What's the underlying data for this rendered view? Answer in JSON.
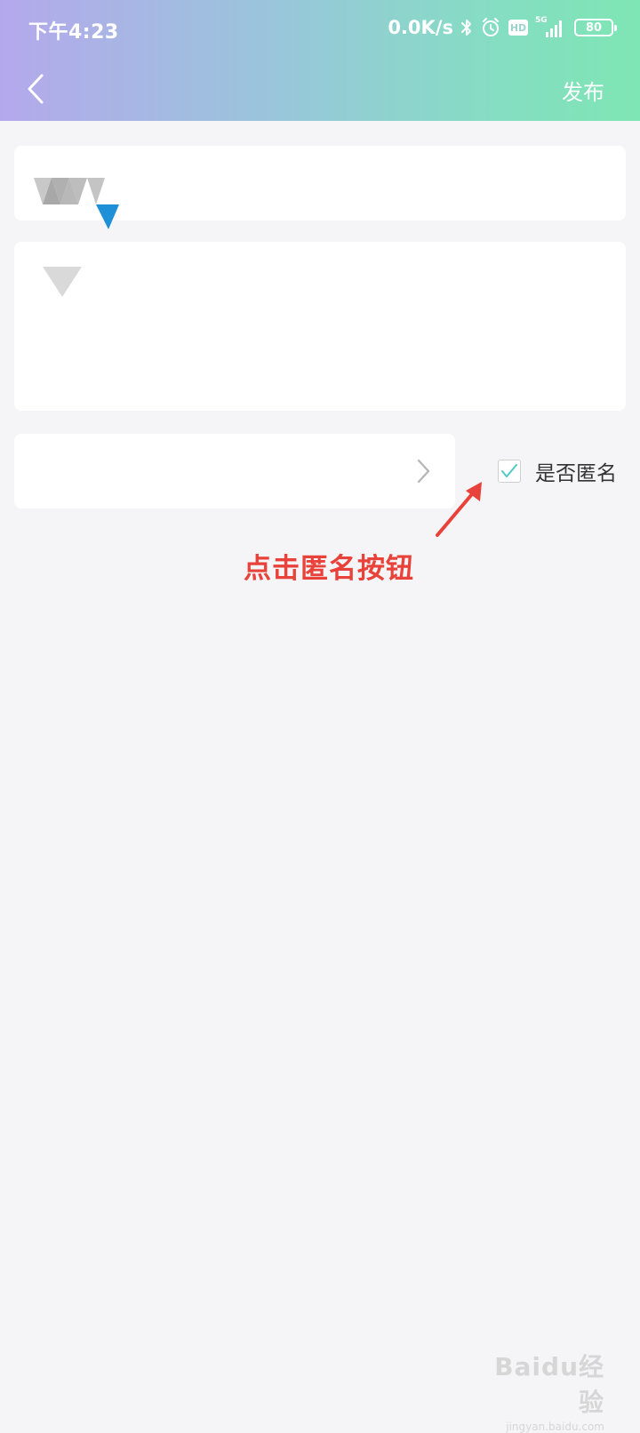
{
  "status_bar": {
    "time": "下午4:23",
    "net_speed": "0.0K/s",
    "hd_label": "HD",
    "network_label": "5G",
    "battery": "80",
    "icons": [
      "bluetooth-icon",
      "alarm-icon",
      "hd-icon",
      "signal-icon",
      "battery-icon"
    ]
  },
  "nav": {
    "back_icon": "chevron-left-icon",
    "publish_label": "发布"
  },
  "form": {
    "anonymous_label": "是否匿名",
    "anonymous_checked": true,
    "select_icon": "chevron-right-icon"
  },
  "annotation": {
    "text": "点击匿名按钮",
    "color": "#e8423a"
  },
  "watermark": {
    "main": "Baidu经验",
    "sub": "jingyan.baidu.com"
  },
  "colors": {
    "header_gradient_start": "#b4a8ec",
    "header_gradient_end": "#7ee6b4",
    "background": "#f5f5f7",
    "checkmark": "#4fc9c3",
    "logo_blue": "#1e90d8"
  }
}
